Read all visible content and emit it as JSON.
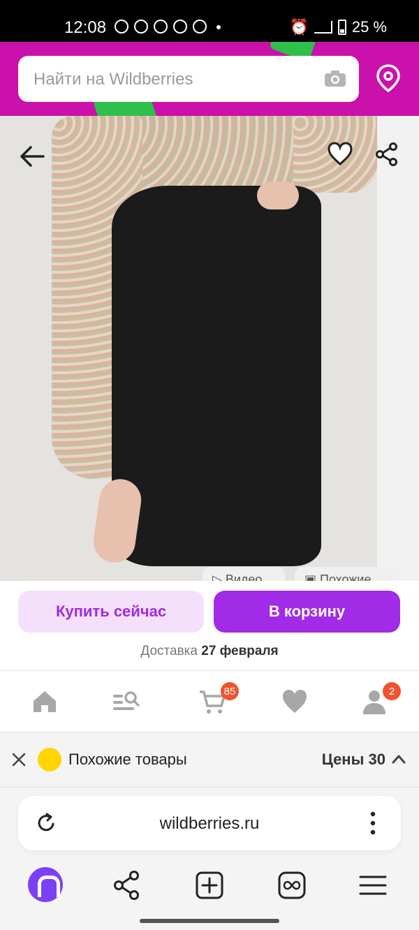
{
  "status_bar": {
    "time": "12:08",
    "battery": "25 %"
  },
  "search": {
    "placeholder": "Найти на Wildberries"
  },
  "product": {
    "chips": [
      "Видео",
      "Похожие"
    ]
  },
  "actions": {
    "buy_now_label": "Купить сейчас",
    "add_to_cart_label": "В корзину",
    "delivery_prefix": "Доставка",
    "delivery_date": "27 февраля"
  },
  "bottom_nav": {
    "cart_badge": "85",
    "profile_badge": "2"
  },
  "similar_bar": {
    "label": "Похожие товары",
    "prices_label": "Цены",
    "prices_count": "30"
  },
  "browser": {
    "url": "wildberries.ru"
  },
  "colors": {
    "brand": "#cb11ab",
    "primary_button": "#a12be6",
    "badge": "#f0532d"
  }
}
